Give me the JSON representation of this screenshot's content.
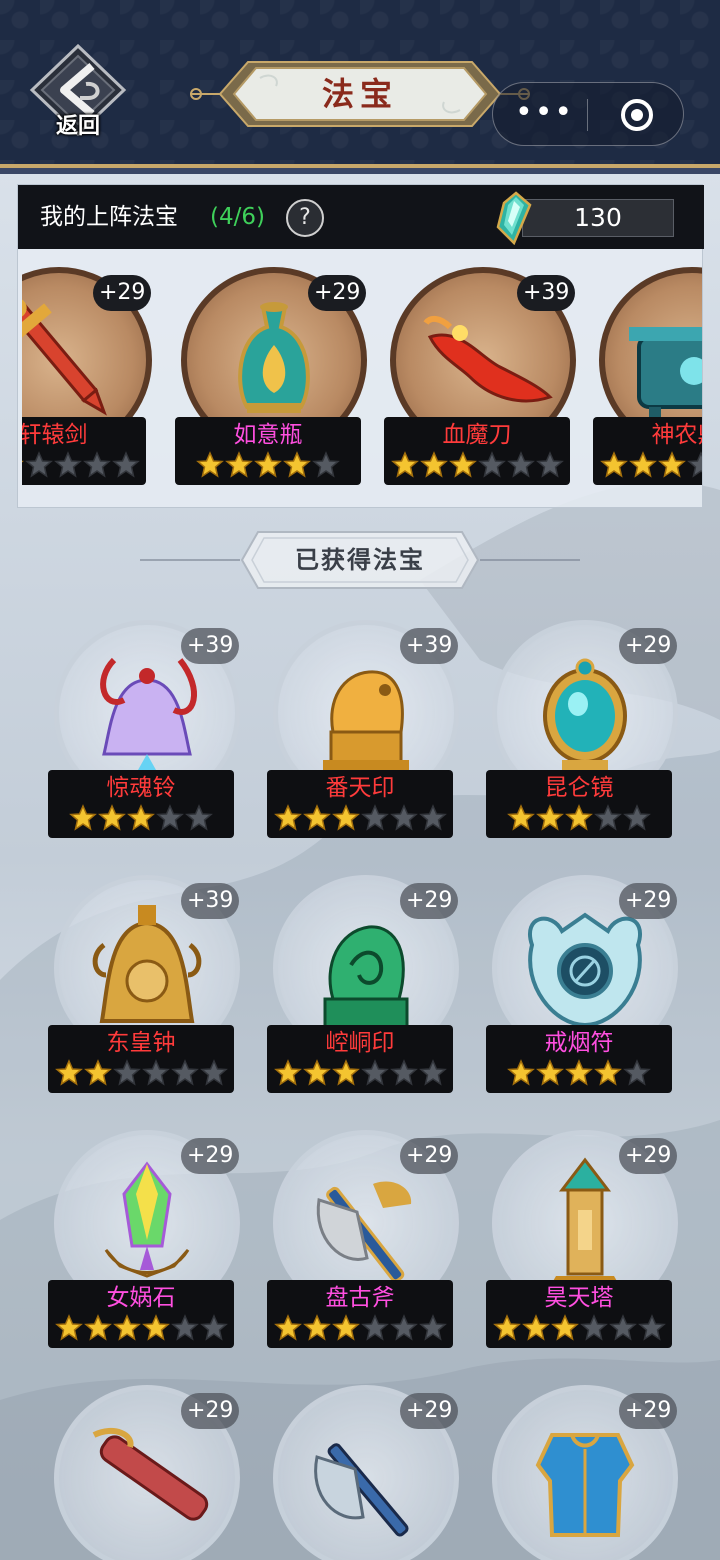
{
  "header": {
    "back_label": "返回",
    "title": "法宝",
    "menu_dots": "•••"
  },
  "equipped": {
    "title": "我的上阵法宝",
    "count": "(4/6)",
    "help": "?",
    "currency_icon": "gem-icon",
    "currency_value": "130",
    "items": [
      {
        "name": "轩辕剑",
        "bonus": "+29",
        "stars": 2,
        "max_stars": 6,
        "name_color": "#ff3b3b",
        "icon": "sword-icon"
      },
      {
        "name": "如意瓶",
        "bonus": "+29",
        "stars": 4,
        "max_stars": 5,
        "name_color": "#ff4fe0",
        "icon": "vase-icon"
      },
      {
        "name": "血魔刀",
        "bonus": "+39",
        "stars": 3,
        "max_stars": 6,
        "name_color": "#ff3b3b",
        "icon": "blade-icon"
      },
      {
        "name": "神农鼎",
        "bonus": "",
        "stars": 3,
        "max_stars": 6,
        "name_color": "#ff3b3b",
        "icon": "cauldron-icon"
      }
    ]
  },
  "owned": {
    "section_title": "已获得法宝",
    "items": [
      {
        "name": "惊魂铃",
        "bonus": "+39",
        "stars": 3,
        "max_stars": 5,
        "name_color": "#ff3b3b",
        "icon": "bell-icon"
      },
      {
        "name": "番天印",
        "bonus": "+39",
        "stars": 3,
        "max_stars": 6,
        "name_color": "#ff3b3b",
        "icon": "seal-icon"
      },
      {
        "name": "昆仑镜",
        "bonus": "+29",
        "stars": 3,
        "max_stars": 5,
        "name_color": "#ff3b3b",
        "icon": "mirror-icon"
      },
      {
        "name": "东皇钟",
        "bonus": "+39",
        "stars": 2,
        "max_stars": 6,
        "name_color": "#ff3b3b",
        "icon": "big-bell-icon"
      },
      {
        "name": "崆峒印",
        "bonus": "+29",
        "stars": 3,
        "max_stars": 6,
        "name_color": "#ff3b3b",
        "icon": "jade-seal-icon"
      },
      {
        "name": "戒烟符",
        "bonus": "+29",
        "stars": 4,
        "max_stars": 5,
        "name_color": "#ff4fe0",
        "icon": "talisman-icon"
      },
      {
        "name": "女娲石",
        "bonus": "+29",
        "stars": 4,
        "max_stars": 6,
        "name_color": "#ff4fe0",
        "icon": "crystal-icon"
      },
      {
        "name": "盘古斧",
        "bonus": "+29",
        "stars": 3,
        "max_stars": 6,
        "name_color": "#ff4fe0",
        "icon": "axe-icon"
      },
      {
        "name": "昊天塔",
        "bonus": "+29",
        "stars": 3,
        "max_stars": 6,
        "name_color": "#ff4fe0",
        "icon": "tower-icon"
      },
      {
        "name": "",
        "bonus": "+29",
        "stars": 0,
        "max_stars": 0,
        "name_color": "#ff4fe0",
        "icon": "guqin-icon"
      },
      {
        "name": "",
        "bonus": "+29",
        "stars": 0,
        "max_stars": 0,
        "name_color": "#ff4fe0",
        "icon": "battle-axe-icon"
      },
      {
        "name": "",
        "bonus": "+29",
        "stars": 0,
        "max_stars": 0,
        "name_color": "#ff4fe0",
        "icon": "armor-icon"
      }
    ]
  },
  "colors": {
    "header_bg": "#1e2b44",
    "gold": "#c8a86a",
    "star_on": "#f4c430",
    "star_off": "#555a62",
    "count_green": "#3fd05a"
  }
}
